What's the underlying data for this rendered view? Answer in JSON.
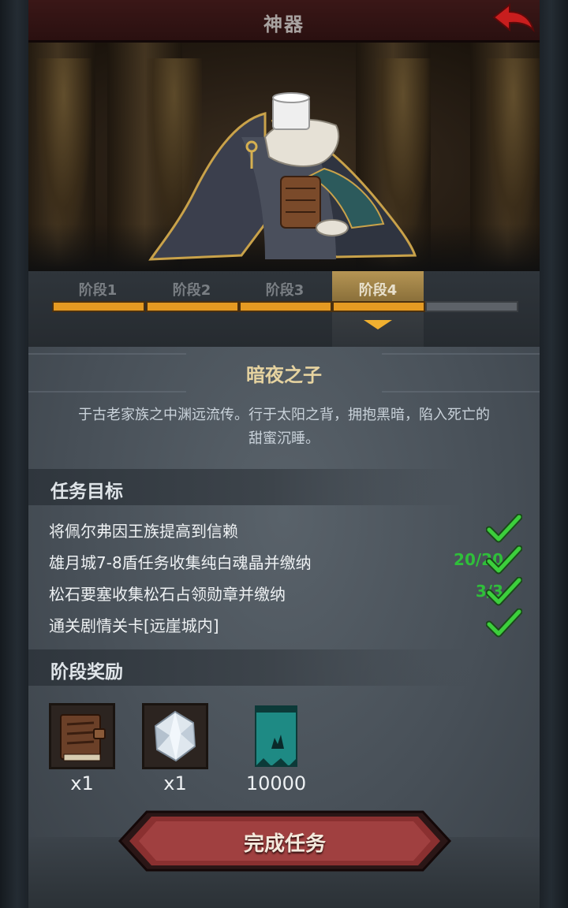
{
  "header": {
    "title": "神器"
  },
  "stages": [
    {
      "label": "阶段1"
    },
    {
      "label": "阶段2"
    },
    {
      "label": "阶段3"
    },
    {
      "label": "阶段4"
    }
  ],
  "current_stage": 4,
  "artifact": {
    "name": "暗夜之子",
    "description_line1": "于古老家族之中渊远流传。行于太阳之背，拥抱黑暗，陷入死亡的",
    "description_line2": "甜蜜沉睡。"
  },
  "tasks_section": {
    "title": "任务目标"
  },
  "tasks": [
    {
      "label": "将佩尔弗因王族提高到信赖",
      "progress": "",
      "completed": true
    },
    {
      "label": "雄月城7-8盾任务收集纯白魂晶并缴纳",
      "progress": "20/20",
      "completed": true
    },
    {
      "label": "松石要塞收集松石占领勋章并缴纳",
      "progress": "3/3",
      "completed": true
    },
    {
      "label": "通关剧情关卡[远崖城内]",
      "progress": "",
      "completed": true
    }
  ],
  "rewards_section": {
    "title": "阶段奖励"
  },
  "rewards": [
    {
      "icon": "book-icon",
      "qty": "x1"
    },
    {
      "icon": "crystal-icon",
      "qty": "x1"
    },
    {
      "icon": "banner-icon",
      "qty": "10000"
    }
  ],
  "complete_button": {
    "label": "完成任务"
  },
  "colors": {
    "accent": "#e59a22",
    "check": "#2fbf3a",
    "name": "#e6d3a0",
    "button": "#7a2a2a"
  }
}
